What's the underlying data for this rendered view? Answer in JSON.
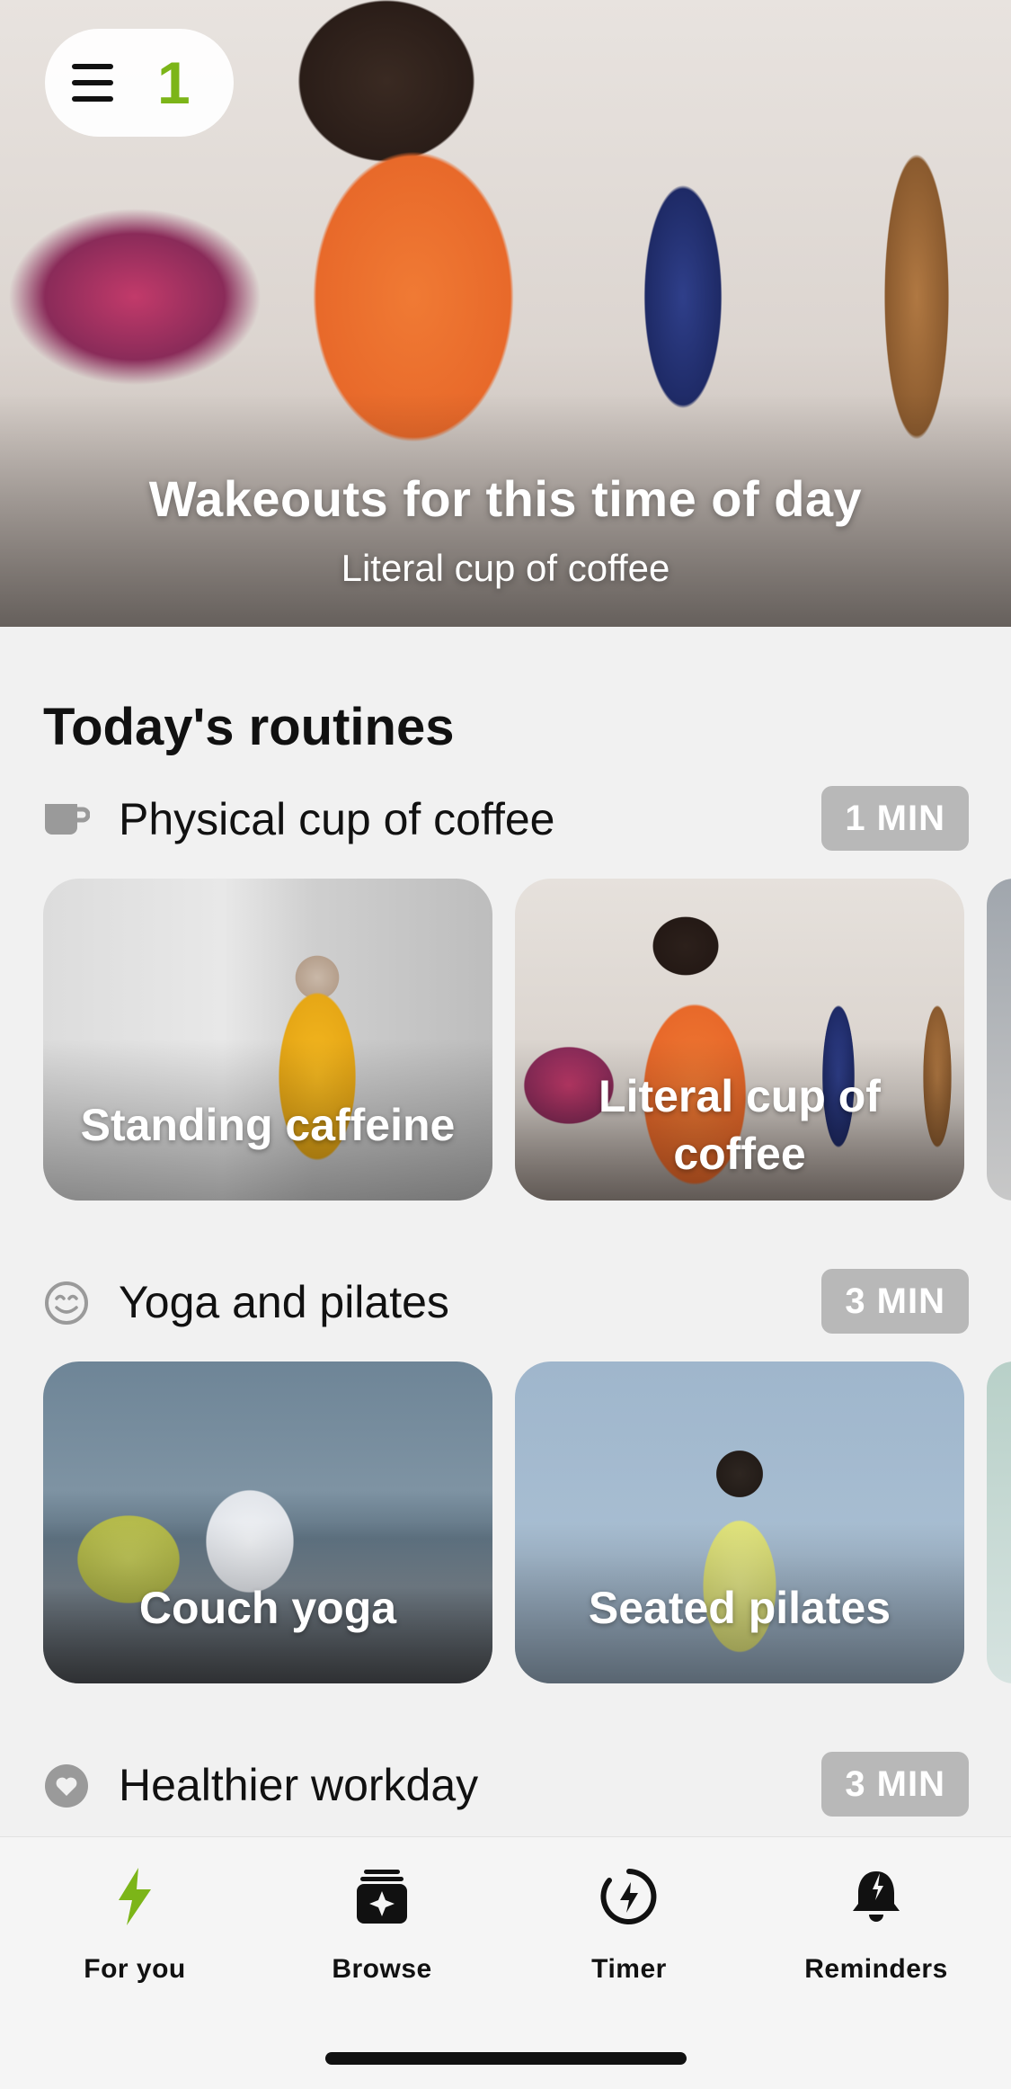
{
  "hero": {
    "title": "Wakeouts for this time of day",
    "subtitle": "Literal cup of coffee",
    "streak_count": "1"
  },
  "section_title": "Today's routines",
  "routines": [
    {
      "icon": "coffee-cup-icon",
      "label": "Physical cup of coffee",
      "duration": "1 MIN",
      "cards": [
        "Standing caffeine",
        "Literal cup of coffee"
      ]
    },
    {
      "icon": "smile-face-icon",
      "label": "Yoga and pilates",
      "duration": "3 MIN",
      "cards": [
        "Couch yoga",
        "Seated pilates"
      ]
    },
    {
      "icon": "heart-icon",
      "label": "Healthier workday",
      "duration": "3 MIN",
      "cards": []
    }
  ],
  "tabs": [
    {
      "label": "For you",
      "icon": "lightning-icon",
      "active": true
    },
    {
      "label": "Browse",
      "icon": "browse-stack-icon",
      "active": false
    },
    {
      "label": "Timer",
      "icon": "timer-icon",
      "active": false
    },
    {
      "label": "Reminders",
      "icon": "bell-icon",
      "active": false
    }
  ],
  "colors": {
    "accent_green": "#7cb518",
    "badge_gray": "#b8b8b8",
    "background": "#f1f1f1"
  }
}
